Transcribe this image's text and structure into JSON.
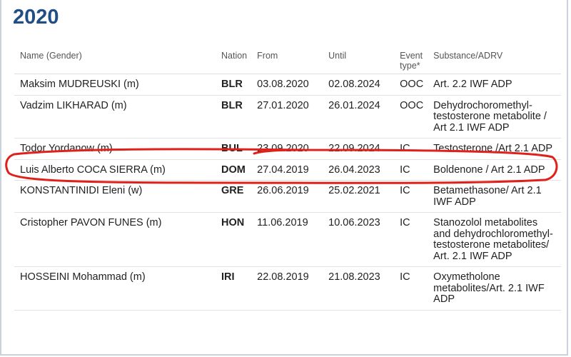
{
  "year": "2020",
  "columns": {
    "name": "Name (Gender)",
    "nation": "Nation",
    "from": "From",
    "until": "Until",
    "event_type": "Event type*",
    "substance": "Substance/ADRV"
  },
  "rows": [
    {
      "name": "Maksim MUDREUSKI (m)",
      "nation": "BLR",
      "from": "03.08.2020",
      "until": "02.08.2024",
      "event": "OOC",
      "substance": "Art. 2.2 IWF ADP"
    },
    {
      "name": "Vadzim LIKHARAD (m)",
      "nation": "BLR",
      "from": "27.01.2020",
      "until": "26.01.2024",
      "event": "OOC",
      "substance": "Dehydrochoromethyl-testosterone metabolite / Art 2.1 IWF ADP"
    },
    {
      "name": "Todor Yordanow (m)",
      "nation": "BUL",
      "from": "23.09.2020",
      "until": "22.09.2024",
      "event": "IC",
      "substance": "Testosterone /Art 2.1 ADP"
    },
    {
      "name": "Luis Alberto COCA SIERRA (m)",
      "nation": "DOM",
      "from": "27.04.2019",
      "until": "26.04.2023",
      "event": "IC",
      "substance": "Boldenone / Art 2.1 ADP"
    },
    {
      "name": "KONSTANTINIDI Eleni (w)",
      "nation": "GRE",
      "from": "26.06.2019",
      "until": "25.02.2021",
      "event": "IC",
      "substance": "Betamethasone/ Art 2.1 IWF ADP"
    },
    {
      "name": "Cristopher PAVON FUNES (m)",
      "nation": "HON",
      "from": "11.06.2019",
      "until": "10.06.2023",
      "event": "IC",
      "substance": "Stanozolol metabolites and dehydrochloromethyl-testosterone metabolites/ Art. 2.1 IWF ADP"
    },
    {
      "name": "HOSSEINI Mohammad (m)",
      "nation": "IRI",
      "from": "22.08.2019",
      "until": "21.08.2023",
      "event": "IC",
      "substance": "Oxymetholone metabolites/Art. 2.1 IWF ADP"
    }
  ],
  "annotation_color": "#e0201b"
}
